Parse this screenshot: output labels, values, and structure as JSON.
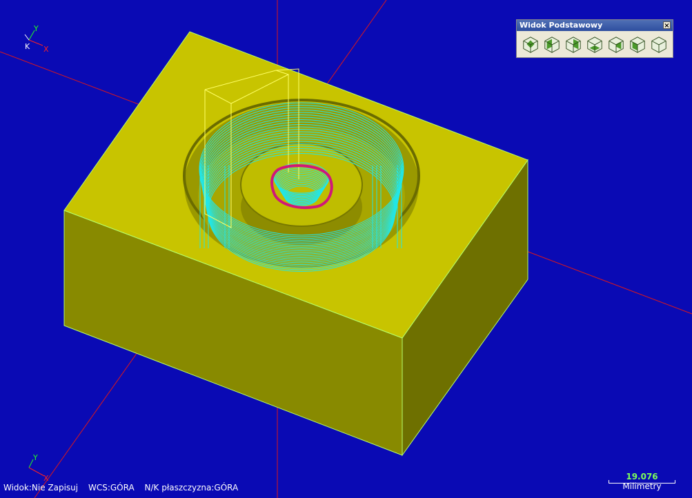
{
  "triad_top": {
    "y": "Y",
    "z": "K",
    "x": "X"
  },
  "triad_bottom": {
    "y": "Y",
    "x": "X"
  },
  "status": {
    "view": "Widok:Nie Zapisuj",
    "wcs": "WCS:GÓRA",
    "plane": "N/K płaszczyzna:GÓRA"
  },
  "scale": {
    "value": "19.076",
    "unit": "Milimetry"
  },
  "toolbar": {
    "title": "Widok Podstawowy",
    "close": "×",
    "buttons": [
      {
        "name": "view-top-icon"
      },
      {
        "name": "view-front-icon"
      },
      {
        "name": "view-back-icon"
      },
      {
        "name": "view-bottom-icon"
      },
      {
        "name": "view-right-icon"
      },
      {
        "name": "view-left-icon"
      },
      {
        "name": "view-isometric-icon"
      }
    ]
  },
  "colors": {
    "background": "#0a0ab4",
    "part_top": "#c8c400",
    "part_front": "#888a00",
    "part_side": "#6e7000",
    "toolpath": "#22e6e6",
    "tool_outline": "#ffff66",
    "axes": "#e01818",
    "selection": "#d01878"
  }
}
